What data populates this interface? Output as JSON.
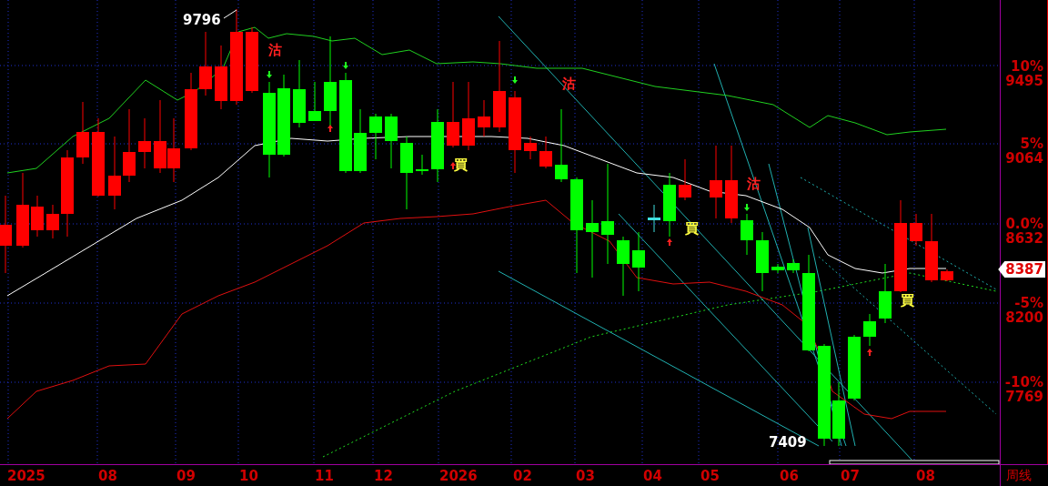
{
  "chart": {
    "high_label": "9796",
    "low_label": "7409",
    "signals": [
      {
        "kind": "sell",
        "text": "沽"
      },
      {
        "kind": "sell",
        "text": "沽"
      },
      {
        "kind": "buy",
        "text": "買"
      },
      {
        "kind": "sell",
        "text": "沽"
      },
      {
        "kind": "buy",
        "text": "買"
      },
      {
        "kind": "buy",
        "text": "買"
      }
    ]
  },
  "price_axis": {
    "ticks": [
      {
        "percent": "10%",
        "price": "9495"
      },
      {
        "percent": "5%",
        "price": "9064"
      },
      {
        "percent": "0.0%",
        "price": "8632"
      },
      {
        "percent": "-5%",
        "price": "8200"
      },
      {
        "percent": "-10%",
        "price": "7769"
      }
    ],
    "current_price": "8387"
  },
  "time_axis": {
    "labels": [
      "2025",
      "08",
      "09",
      "10",
      "11",
      "12",
      "2026",
      "02",
      "03",
      "04",
      "05",
      "06",
      "07",
      "08"
    ],
    "period": "周线"
  }
}
